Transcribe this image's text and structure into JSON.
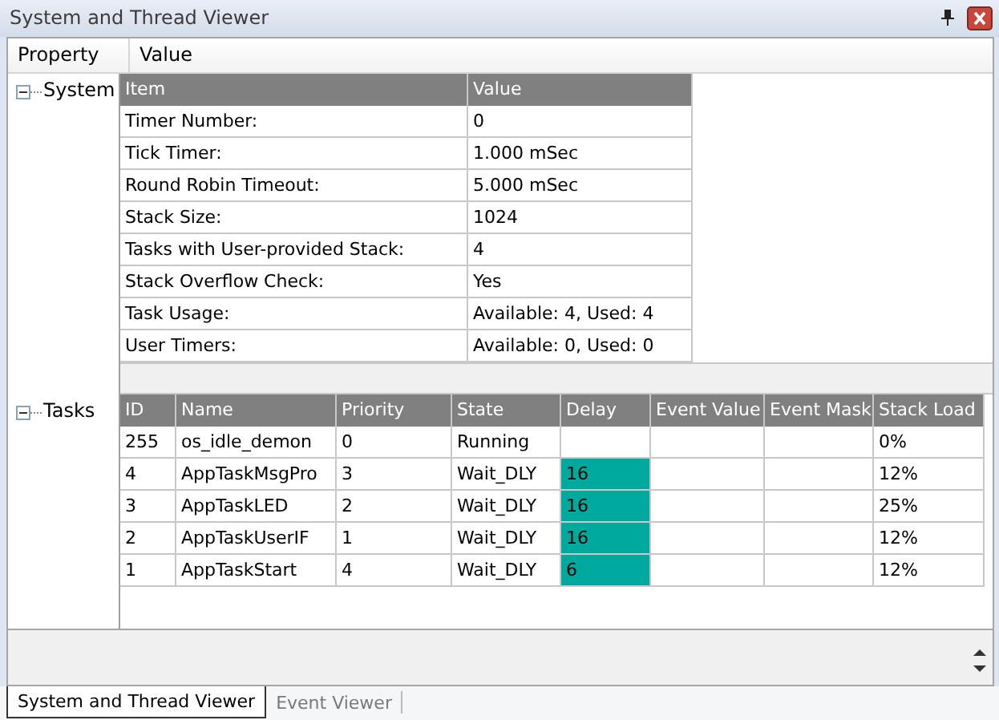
{
  "window": {
    "title": "System and Thread Viewer"
  },
  "columns": [
    "Property",
    "Value"
  ],
  "system": {
    "label": "System",
    "expanded": true,
    "columns": [
      "Item",
      "Value"
    ],
    "rows": [
      [
        "Timer Number:",
        "0"
      ],
      [
        "Tick Timer:",
        "1.000 mSec"
      ],
      [
        "Round Robin Timeout:",
        "5.000 mSec"
      ],
      [
        "Stack Size:",
        "1024"
      ],
      [
        "Tasks with User-provided Stack:",
        "4"
      ],
      [
        "Stack Overflow Check:",
        "Yes"
      ],
      [
        "Task Usage:",
        "Available: 4, Used: 4"
      ],
      [
        "User Timers:",
        "Available: 0, Used: 0"
      ]
    ]
  },
  "tasks": {
    "label": "Tasks",
    "expanded": true,
    "columns": [
      "ID",
      "Name",
      "Priority",
      "State",
      "Delay",
      "Event Value",
      "Event Mask",
      "Stack Load"
    ],
    "rows": [
      {
        "cells": [
          "255",
          "os_idle_demon",
          "0",
          "Running",
          "",
          "",
          "",
          "0%"
        ],
        "delay_active": false
      },
      {
        "cells": [
          "4",
          "AppTaskMsgPro",
          "3",
          "Wait_DLY",
          "16",
          "",
          "",
          "12%"
        ],
        "delay_active": true
      },
      {
        "cells": [
          "3",
          "AppTaskLED",
          "2",
          "Wait_DLY",
          "16",
          "",
          "",
          "25%"
        ],
        "delay_active": true
      },
      {
        "cells": [
          "2",
          "AppTaskUserIF",
          "1",
          "Wait_DLY",
          "16",
          "",
          "",
          "12%"
        ],
        "delay_active": true
      },
      {
        "cells": [
          "1",
          "AppTaskStart",
          "4",
          "Wait_DLY",
          "6",
          "",
          "",
          "12%"
        ],
        "delay_active": true
      }
    ]
  },
  "tabs": [
    {
      "label": "System and Thread Viewer",
      "selected": true
    },
    {
      "label": "Event Viewer",
      "selected": false
    }
  ]
}
